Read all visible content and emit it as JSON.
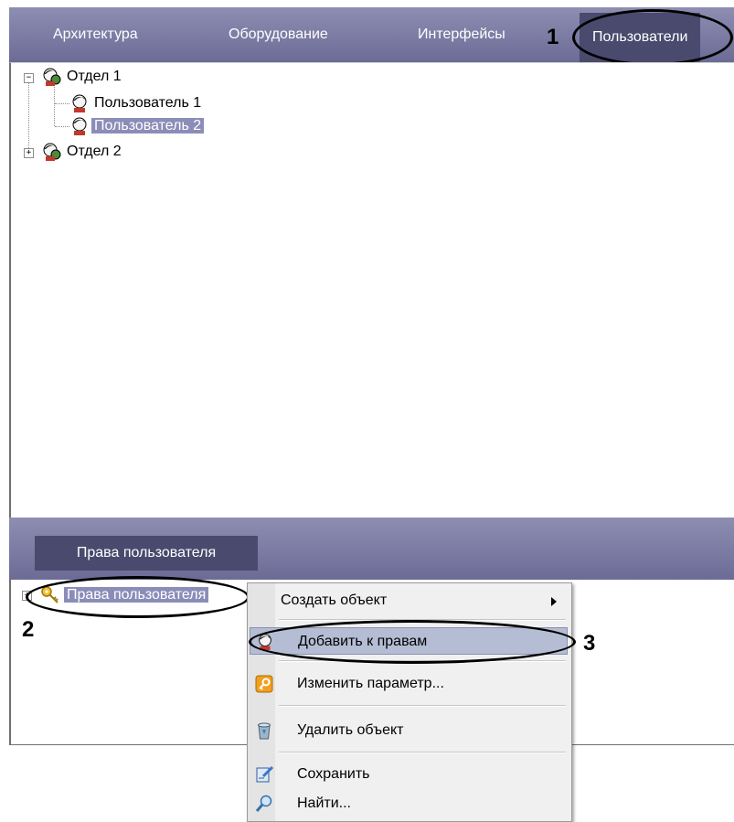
{
  "top_tabs": [
    "Архитектура",
    "Оборудование",
    "Интерфейсы",
    "Пользователи"
  ],
  "tree": {
    "dept1": "Отдел 1",
    "user1": "Пользователь 1",
    "user2": "Пользователь 2",
    "dept2": "Отдел 2"
  },
  "rights_tab": "Права пользователя",
  "rights_tree_item": "Права пользователя",
  "context_menu": {
    "create": "Создать объект",
    "add_to_rights": "Добавить к правам",
    "change_param": "Изменить параметр...",
    "delete": "Удалить объект",
    "save": "Сохранить",
    "find": "Найти..."
  },
  "callouts": {
    "one": "1",
    "two": "2",
    "three": "3"
  },
  "icons": {
    "user": "user-face-icon",
    "group": "group-icon",
    "key": "key-icon",
    "param": "key-param-icon",
    "trash": "recycle-bin-icon",
    "save": "save-icon",
    "find": "magnifier-icon",
    "expand": "plus-box-icon",
    "collapse": "minus-box-icon"
  },
  "colors": {
    "tab_bar": "#7d7da5",
    "active_tab": "#4a4a6e",
    "selection": "#8b8db8",
    "menu_highlight": "#b5bdd4"
  }
}
